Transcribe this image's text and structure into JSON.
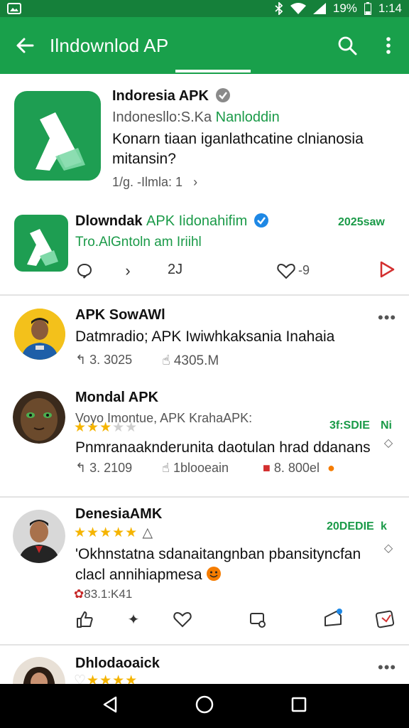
{
  "status_bar": {
    "battery": "19%",
    "time": "1:14"
  },
  "app_bar": {
    "title": "Ilndownlod AP",
    "back_icon": "arrow-back-icon",
    "search_icon": "search-icon",
    "menu_icon": "more-vert-icon"
  },
  "featured": {
    "name": "Indoresia APK",
    "sub_prefix": "Indonesllo:S.Ka ",
    "sub_green": "Nanloddin",
    "desc_line1": "Konarn tiaan iganlathcatine clnianosia",
    "desc_line2": "mitansin?",
    "meta": "1/g. -Ilmla: 1"
  },
  "post1": {
    "name": "Dlowndak ",
    "name_green": "APK Iidonahifim",
    "date": "2025saw",
    "subtitle": "Tro.AlGntoln am Iriihl",
    "count": "2J",
    "likes": "-9"
  },
  "comments": [
    {
      "name": "APK SowAWl",
      "text": "Datmradio; APK Iwiwhkaksania Inahaia",
      "replies": "3. 3025",
      "likes": "4305.M"
    },
    {
      "name": "Mondal APK",
      "subtitle": "Voyo Imontue, APK KrahaAPK:",
      "date": "3f:SDIE",
      "badge": "Ni",
      "text": "Pnmranaaknderunita daotulan hrad ddanans",
      "replies": "3. 2109",
      "likes": "1blooeain",
      "extra": "8. 800el",
      "rating": 3
    },
    {
      "name": "DenesiaAMK",
      "date": "20DEDIE",
      "badge": "k",
      "text_line1": "'Okhnstatna sdanaitangnban pbansityncfan",
      "text_line2": "clacl annihiapmesa",
      "meta": "83.1:K41",
      "rating": 5
    },
    {
      "name": "Dhlodaoaick"
    }
  ],
  "colors": {
    "primary": "#19a04b",
    "status": "#15803a",
    "accent_red": "#d32f2f",
    "verified": "#1e88e5",
    "star": "#f5b400"
  }
}
